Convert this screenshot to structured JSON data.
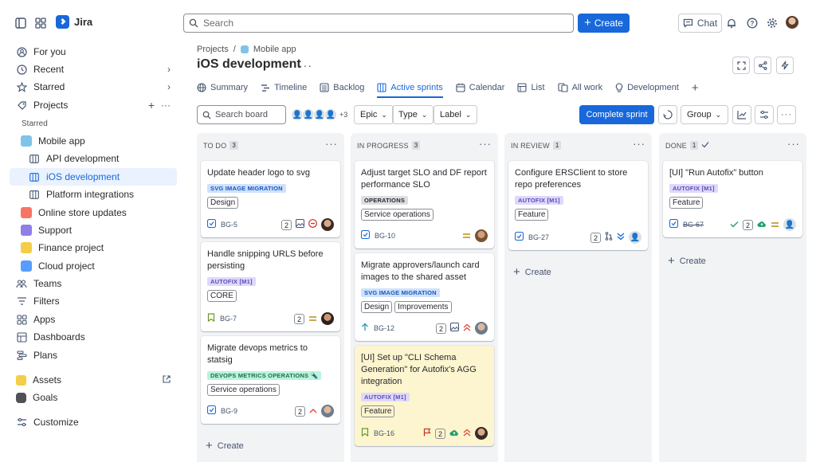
{
  "app": {
    "name": "Jira"
  },
  "topbar": {
    "search_placeholder": "Search",
    "create_label": "Create",
    "chat_label": "Chat"
  },
  "sidebar": {
    "for_you": "For you",
    "recent": "Recent",
    "starred": "Starred",
    "projects": "Projects",
    "starred_section": "Starred",
    "mobile_app": "Mobile app",
    "api_development": "API development",
    "ios_development": "iOS development",
    "platform_integrations": "Platform integrations",
    "online_store_updates": "Online store updates",
    "support": "Support",
    "finance_project": "Finance project",
    "cloud_project": "Cloud project",
    "teams": "Teams",
    "filters": "Filters",
    "apps": "Apps",
    "dashboards": "Dashboards",
    "plans": "Plans",
    "assets": "Assets",
    "goals": "Goals",
    "customize": "Customize"
  },
  "header": {
    "breadcrumb_projects": "Projects",
    "breadcrumb_sep": "/",
    "breadcrumb_project": "Mobile app",
    "title": "iOS development",
    "tabs": [
      "Summary",
      "Timeline",
      "Backlog",
      "Active sprints",
      "Calendar",
      "List",
      "All work",
      "Development"
    ]
  },
  "toolbar": {
    "search_placeholder": "Search board",
    "avatar_more": "+3",
    "epic": "Epic",
    "type": "Type",
    "label": "Label",
    "complete_sprint": "Complete sprint",
    "group": "Group"
  },
  "colors": {
    "accent": "#1868db",
    "autofix_bg": "#dfd8fd",
    "autofix_fg": "#5e4db2",
    "svg_bg": "#cfe1fd",
    "svg_fg": "#1858bb",
    "ops_bg": "#dddee1",
    "devops_bg": "#baf3db",
    "devops_fg": "#216e4e",
    "yellow_card": "#fdf5cf"
  },
  "columns": [
    {
      "name": "TO DO",
      "count": "3",
      "create_label": "Create",
      "cards": [
        {
          "title": "Update header logo to svg",
          "lozenge": "SVG IMAGE MIGRATION",
          "tags": [
            "Design"
          ],
          "key": "BG-5",
          "estimate": "2"
        },
        {
          "title": "Handle snipping URLS before persisting",
          "lozenge": "AUTOFIX [M1]",
          "tags": [
            "CORE"
          ],
          "key": "BG-7",
          "estimate": "2"
        },
        {
          "title": "Migrate devops metrics to statsig",
          "lozenge": "DEVOPS METRICS OPERATIONS 🔦",
          "tags": [
            "Service operations"
          ],
          "key": "BG-9",
          "estimate": "2"
        }
      ]
    },
    {
      "name": "IN PROGRESS",
      "count": "3",
      "cards": [
        {
          "title": "Adjust target SLO and DF report performance SLO",
          "lozenge": "OPERATIONS",
          "tags": [
            "Service operations"
          ],
          "key": "BG-10"
        },
        {
          "title": "Migrate approvers/launch card images to the shared asset",
          "lozenge": "SVG IMAGE MIGRATION",
          "tags": [
            "Design",
            "Improvements"
          ],
          "key": "BG-12",
          "estimate": "2"
        },
        {
          "title": "[UI] Set up \"CLI Schema Generation\" for Autofix's AGG integration",
          "lozenge": "AUTOFIX [M1]",
          "tags": [
            "Feature"
          ],
          "key": "BG-16",
          "estimate": "2"
        }
      ]
    },
    {
      "name": "IN REVIEW",
      "count": "1",
      "create_label": "Create",
      "cards": [
        {
          "title": "Configure ERSClient to store repo preferences",
          "lozenge": "AUTOFIX [M1]",
          "tags": [
            "Feature"
          ],
          "key": "BG-27",
          "estimate": "2"
        }
      ]
    },
    {
      "name": "DONE",
      "count": "1",
      "create_label": "Create",
      "cards": [
        {
          "title": "[UI] \"Run Autofix\" button",
          "lozenge": "AUTOFIX [M1]",
          "tags": [
            "Feature"
          ],
          "key": "BG-67",
          "estimate": "2"
        }
      ]
    }
  ]
}
